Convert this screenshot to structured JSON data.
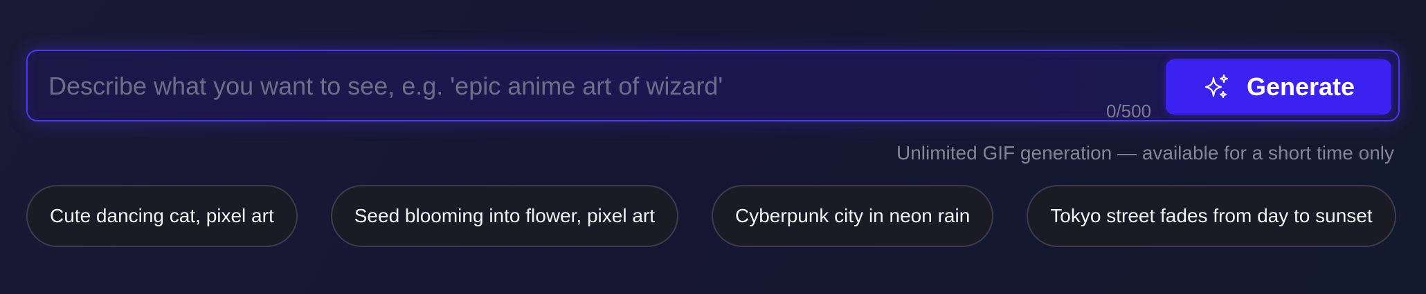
{
  "prompt": {
    "value": "",
    "placeholder": "Describe what you want to see, e.g. 'epic anime art of wizard'",
    "char_count": "0/500"
  },
  "generate_button": {
    "label": "Generate",
    "icon": "sparkles-icon",
    "color": "#3b22f0"
  },
  "notice": "Unlimited GIF generation — available for a short time only",
  "suggestions": [
    "Cute dancing cat, pixel art",
    "Seed blooming into flower, pixel art",
    "Cyberpunk city in neon rain",
    "Tokyo street fades from day to sunset"
  ],
  "colors": {
    "accent": "#3b22f0",
    "border_glow": "#4a37f0",
    "background": "#161633"
  }
}
